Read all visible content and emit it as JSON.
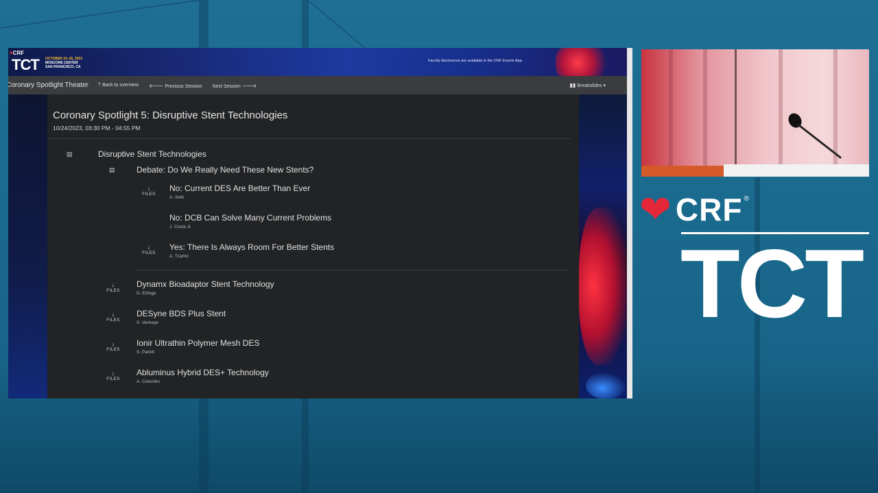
{
  "banner": {
    "crf_logo": "CRF",
    "tct_logo": "TCT",
    "event_dates": "OCTOBER 23–26, 2023",
    "event_venue": "MOSCONE CENTER",
    "event_city": "SAN FRANCISCO, CA",
    "disclosure": "Faculty disclosures are available in the CRF Events App."
  },
  "navbar": {
    "brand": "Coronary Spotlight Theater",
    "back": "Back to overview",
    "previous": "Previous Session",
    "next": "Next Session",
    "breakslides": "Breakslides"
  },
  "session": {
    "title": "Coronary Spotlight 5: Disruptive Stent Technologies",
    "time": "10/24/2023, 03:30 PM - 04:55 PM"
  },
  "agenda": {
    "group_title": "Disruptive Stent Technologies",
    "debate_title": "Debate: Do We Really Need These New Stents?",
    "files_label": "FILES",
    "debate_items": [
      {
        "title": "No: Current DES Are Better Than Ever",
        "author": "A. Seth"
      },
      {
        "title": "No: DCB Can Solve Many Current Problems",
        "author": "J. Costa Jr"
      },
      {
        "title": "Yes: There Is Always Room For Better Stents",
        "author": "A. Tzafriri"
      }
    ],
    "talks": [
      {
        "title": "Dynamx Bioadaptor Stent Technology",
        "author": "D. Erlinge"
      },
      {
        "title": "DESyne BDS Plus Stent",
        "author": "S. Verheye"
      },
      {
        "title": "Ionir Ultrathin Polymer Mesh DES",
        "author": "S. Parikh"
      },
      {
        "title": "Abluminus Hybrid DES+ Technology",
        "author": "A. Colombo"
      }
    ]
  },
  "side_brand": {
    "crf": "CRF",
    "registered": "®",
    "tct": "TCT"
  }
}
